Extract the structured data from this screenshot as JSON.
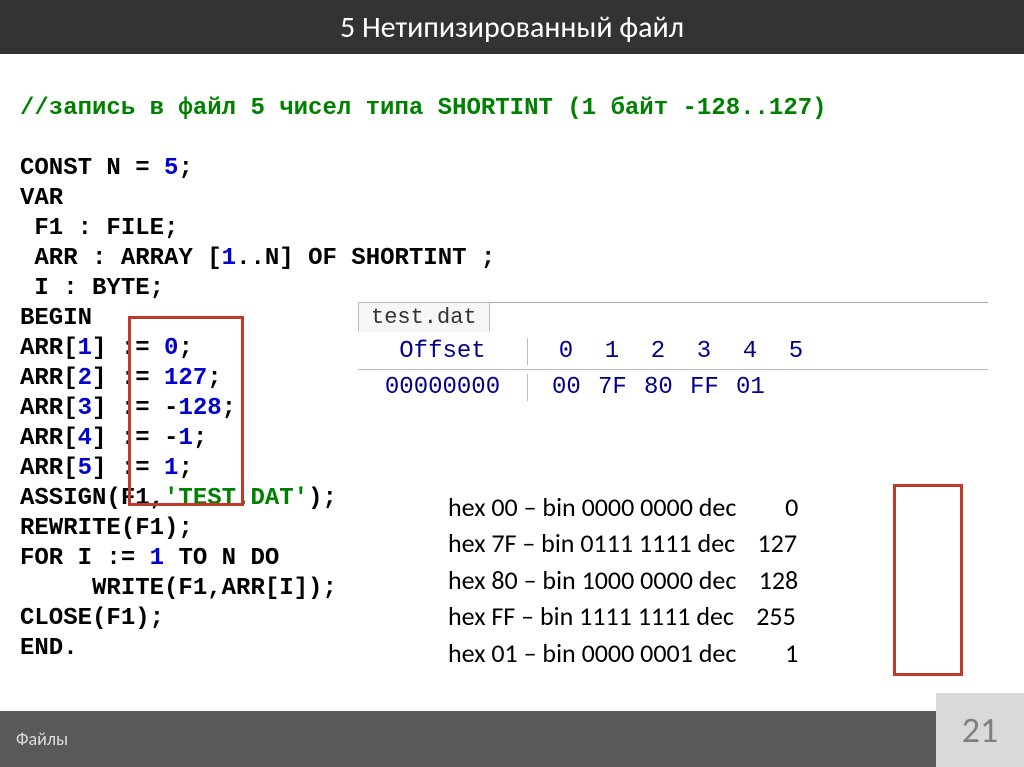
{
  "title": "5 Нетипизированный файл",
  "comment": "//запись в файл 5 чисел типа SHORTINT (1 байт -128..127)",
  "code": {
    "l1a": "CONST",
    "l1b": " N = ",
    "l1c": "5",
    "l1d": ";",
    "l2": "VAR",
    "l3": " F1 : FILE;",
    "l4a": " ARR : ",
    "l4b": "ARRAY",
    "l4c": " [",
    "l4d": "1",
    "l4e": "..N] ",
    "l4f": "OF",
    "l4g": " SHORTINT ;",
    "l5": " I : BYTE;",
    "l6": "BEGIN",
    "l7a": "ARR[",
    "l7b": "1",
    "l7c": "] := ",
    "l7d": "0",
    "l7e": ";",
    "l8a": "ARR[",
    "l8b": "2",
    "l8c": "] := ",
    "l8d": "127",
    "l8e": ";",
    "l9a": "ARR[",
    "l9b": "3",
    "l9c": "] := -",
    "l9d": "128",
    "l9e": ";",
    "l10a": "ARR[",
    "l10b": "4",
    "l10c": "] := -",
    "l10d": "1",
    "l10e": ";",
    "l11a": "ARR[",
    "l11b": "5",
    "l11c": "] := ",
    "l11d": "1",
    "l11e": ";",
    "l12a": "ASSIGN(F1,",
    "l12b": "'TEST.DAT'",
    "l12c": ");",
    "l13": "REWRITE(F1);",
    "l14a": "FOR",
    "l14b": " I := ",
    "l14c": "1",
    "l14d": " ",
    "l14e": "TO",
    "l14f": " N ",
    "l14g": "DO",
    "l15": "     WRITE(F1,ARR[I]);",
    "l16": "CLOSE(F1);",
    "l17": "END."
  },
  "hex": {
    "filename": "test.dat",
    "offset_label": "Offset",
    "cols": [
      "0",
      "1",
      "2",
      "3",
      "4",
      "5"
    ],
    "addr": "00000000",
    "bytes": [
      "00",
      "7F",
      "80",
      "FF",
      "01"
    ]
  },
  "conv": [
    {
      "hex": "00",
      "bin": "0000 0000",
      "dec": "0"
    },
    {
      "hex": "7F",
      "bin": "0111 1111",
      "dec": "127"
    },
    {
      "hex": "80",
      "bin": "1000 0000",
      "dec": "128"
    },
    {
      "hex": "FF",
      "bin": "1111 1111",
      "dec": "255"
    },
    {
      "hex": "01",
      "bin": "0000 0001",
      "dec": "1"
    }
  ],
  "footer": "Файлы",
  "page": "21"
}
